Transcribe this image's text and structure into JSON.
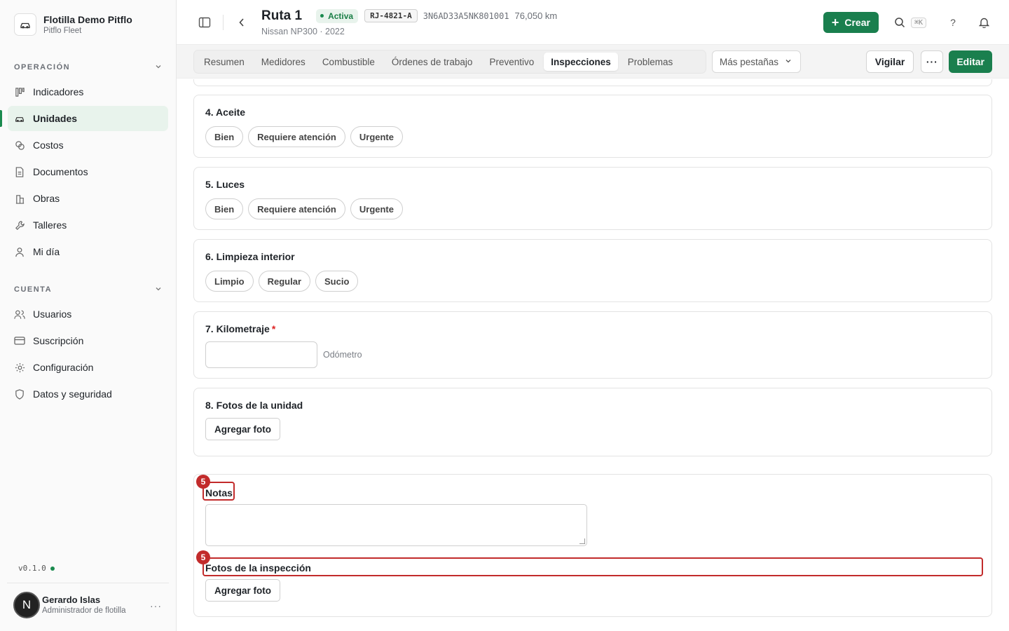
{
  "org": {
    "name": "Flotilla Demo Pitflo",
    "subtitle": "Pitflo Fleet"
  },
  "sidebar": {
    "operacion_label": "OPERACIÓN",
    "operacion_items": [
      {
        "label": "Indicadores",
        "icon": "kanban-icon"
      },
      {
        "label": "Unidades",
        "icon": "car-icon",
        "active": true
      },
      {
        "label": "Costos",
        "icon": "coins-icon"
      },
      {
        "label": "Documentos",
        "icon": "document-icon"
      },
      {
        "label": "Obras",
        "icon": "building-icon"
      },
      {
        "label": "Talleres",
        "icon": "wrench-icon"
      },
      {
        "label": "Mi día",
        "icon": "user-icon"
      }
    ],
    "cuenta_label": "CUENTA",
    "cuenta_items": [
      {
        "label": "Usuarios",
        "icon": "users-icon"
      },
      {
        "label": "Suscripción",
        "icon": "credit-card-icon"
      },
      {
        "label": "Configuración",
        "icon": "gear-icon"
      },
      {
        "label": "Datos y seguridad",
        "icon": "shield-icon"
      }
    ],
    "version": "v0.1.0"
  },
  "user": {
    "initial": "N",
    "name": "Gerardo Islas",
    "role": "Administrador de flotilla",
    "more": "···"
  },
  "header": {
    "title": "Ruta 1",
    "status": "Activa",
    "plate": "RJ-4821-A",
    "vin": "3N6AD33A5NK801001",
    "km": "76,050 km",
    "subtitle": "Nissan NP300 · 2022",
    "create_label": "Crear",
    "shortcut": "⌘K",
    "help": "?"
  },
  "tabs": [
    "Resumen",
    "Medidores",
    "Combustible",
    "Órdenes de trabajo",
    "Preventivo",
    "Inspecciones",
    "Problemas"
  ],
  "active_tab": "Inspecciones",
  "more_tabs_label": "Más pestañas",
  "actions": {
    "watch_label": "Vigilar",
    "more": "···",
    "edit_label": "Editar"
  },
  "questions": {
    "q4": {
      "title": "4. Aceite",
      "options": [
        "Bien",
        "Requiere atención",
        "Urgente"
      ]
    },
    "q5": {
      "title": "5. Luces",
      "options": [
        "Bien",
        "Requiere atención",
        "Urgente"
      ]
    },
    "q6": {
      "title": "6. Limpieza interior",
      "options": [
        "Limpio",
        "Regular",
        "Sucio"
      ]
    },
    "q7": {
      "title": "7. Kilometraje",
      "required": "*",
      "unit": "Odómetro",
      "value": ""
    },
    "q8": {
      "title": "8. Fotos de la unidad",
      "button": "Agregar foto"
    }
  },
  "final": {
    "notes_label": "Notas",
    "notes_value": "",
    "photos_label": "Fotos de la inspección",
    "photos_button": "Agregar foto",
    "marker_notes": "5",
    "marker_photos": "5"
  },
  "colors": {
    "accent": "#1a7f4e",
    "highlight": "#c22b2b"
  }
}
